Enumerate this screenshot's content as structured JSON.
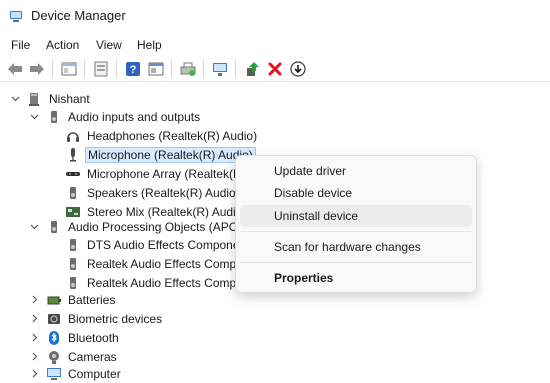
{
  "window": {
    "title": "Device Manager",
    "icon": "device-manager-icon"
  },
  "menu": [
    "File",
    "Action",
    "View",
    "Help"
  ],
  "toolbar": {
    "buttons": [
      "back-arrow-icon",
      "forward-arrow-icon",
      "properties-icon",
      "refresh-icon",
      "help-icon",
      "view-icon",
      "print-icon",
      "monitor-icon",
      "update-driver-icon",
      "uninstall-x-icon",
      "download-icon"
    ],
    "uninstall_color": "#e81123"
  },
  "tree": {
    "root": {
      "label": "Nishant",
      "icon": "computer-icon",
      "expanded": true
    },
    "categories": [
      {
        "label": "Audio inputs and outputs",
        "icon": "speaker-icon",
        "expanded": true,
        "children": [
          {
            "label": "Headphones (Realtek(R) Audio)",
            "icon": "headphones-icon"
          },
          {
            "label": "Microphone (Realtek(R) Audio)",
            "icon": "microphone-icon",
            "selected": true
          },
          {
            "label": "Microphone Array (Realtek(R",
            "icon": "microphone-array-icon"
          },
          {
            "label": "Speakers (Realtek(R) Audio)",
            "icon": "speaker-icon"
          },
          {
            "label": "Stereo Mix (Realtek(R) Audio",
            "icon": "circuit-board-icon"
          }
        ]
      },
      {
        "label": "Audio Processing Objects (APOs",
        "icon": "speaker-icon",
        "expanded": true,
        "children": [
          {
            "label": "DTS Audio Effects Compone",
            "icon": "speaker-icon"
          },
          {
            "label": "Realtek Audio Effects Compo",
            "icon": "speaker-icon"
          },
          {
            "label": "Realtek Audio Effects Compo",
            "icon": "speaker-icon"
          }
        ]
      },
      {
        "label": "Batteries",
        "icon": "battery-icon",
        "expanded": false
      },
      {
        "label": "Biometric devices",
        "icon": "biometric-icon",
        "expanded": false
      },
      {
        "label": "Bluetooth",
        "icon": "bluetooth-icon",
        "expanded": false
      },
      {
        "label": "Cameras",
        "icon": "camera-icon",
        "expanded": false
      },
      {
        "label": "Computer",
        "icon": "computer-icon",
        "expanded": false
      }
    ]
  },
  "context_menu": {
    "items": [
      {
        "label": "Update driver"
      },
      {
        "label": "Disable device"
      },
      {
        "label": "Uninstall device",
        "hovered": true
      },
      {
        "label": "Scan for hardware changes"
      },
      {
        "label": "Properties",
        "bold": true
      }
    ]
  }
}
